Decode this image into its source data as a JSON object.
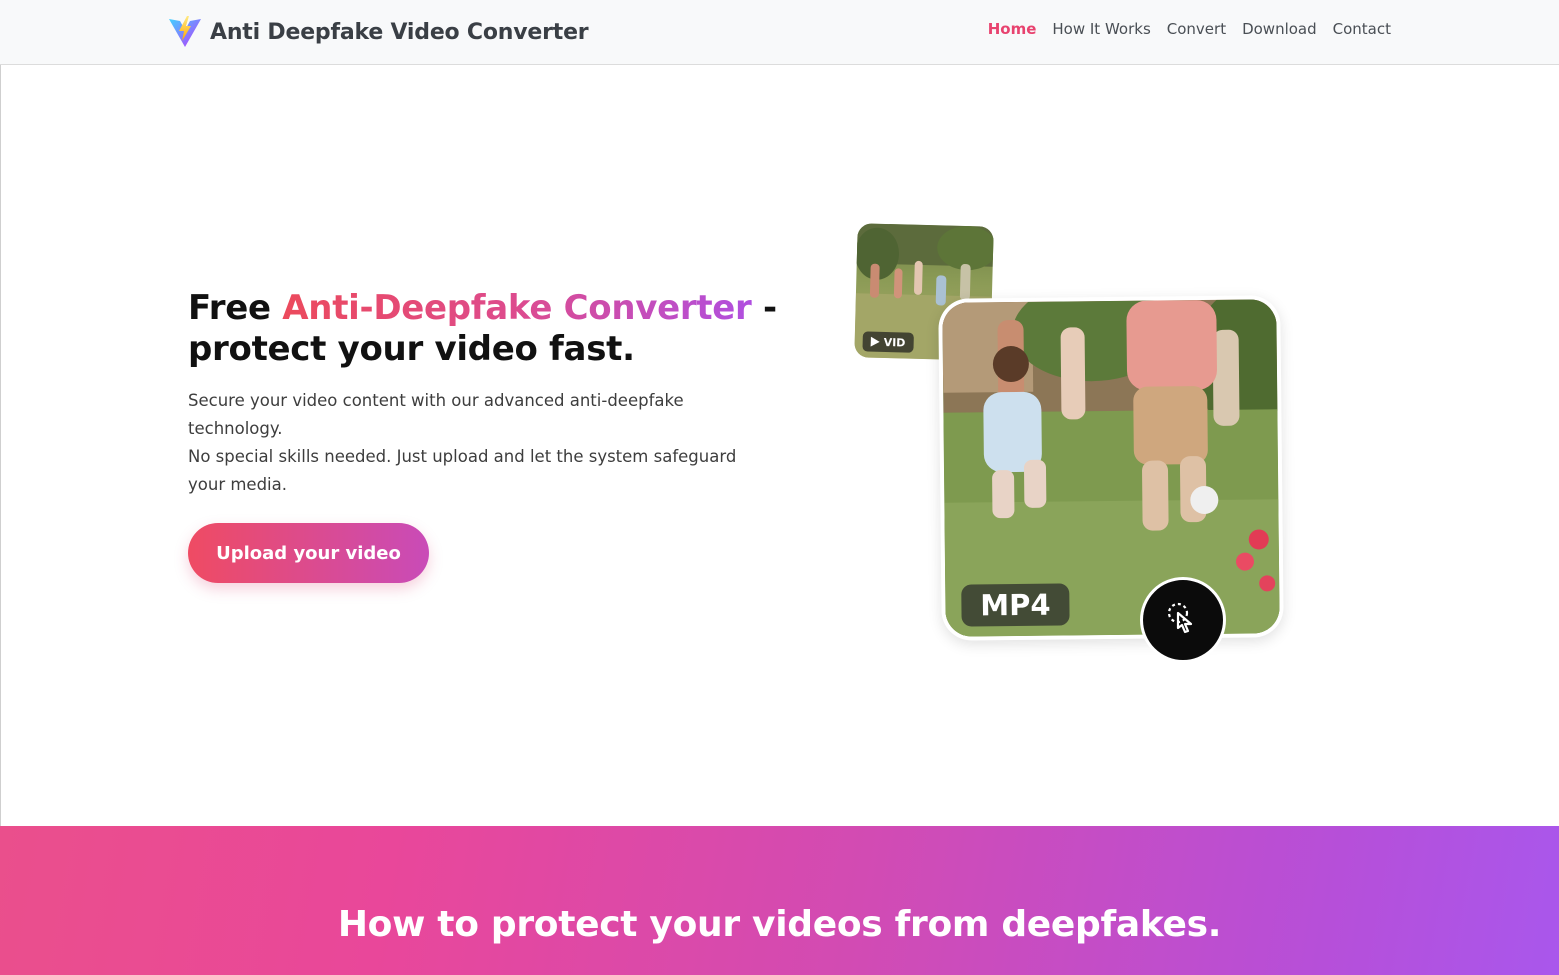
{
  "header": {
    "brand_name": "Anti Deepfake Video Converter",
    "logo_icon": "lightning-v-logo",
    "nav": [
      {
        "label": "Home",
        "active": true
      },
      {
        "label": "How It Works",
        "active": false
      },
      {
        "label": "Convert",
        "active": false
      },
      {
        "label": "Download",
        "active": false
      },
      {
        "label": "Contact",
        "active": false
      }
    ]
  },
  "hero": {
    "title_prefix": "Free ",
    "title_highlight": "Anti-Deepfake Converter",
    "title_suffix_line1": " -",
    "title_line2": "protect your video fast.",
    "description_line1": "Secure your video content with our advanced anti-deepfake technology.",
    "description_line2": "No special skills needed. Just upload and let the system safeguard your media.",
    "upload_button_label": "Upload your video"
  },
  "illustration": {
    "small_badge_label": "VID",
    "format_badge_label": "MP4",
    "fab_icon": "tap-convert-icon"
  },
  "section_how": {
    "title": "How to protect your videos from deepfakes."
  },
  "colors": {
    "accent": "#e8436f",
    "gradient_start": "#ef4b63",
    "gradient_end": "#a957ec"
  }
}
